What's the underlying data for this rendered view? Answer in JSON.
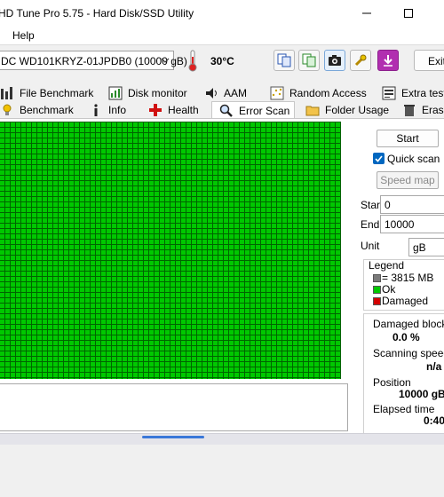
{
  "window": {
    "title": "HD Tune Pro 5.75 - Hard Disk/SSD Utility"
  },
  "menu": {
    "help": "Help"
  },
  "toolbar": {
    "drive": "DC WD101KRYZ-01JPDB0 (10000 gB)",
    "temperature": "30°C",
    "exit_label": "Exit"
  },
  "tabs_row1": [
    {
      "label": "File Benchmark",
      "icon": "file-benchmark-icon"
    },
    {
      "label": "Disk monitor",
      "icon": "disk-monitor-icon"
    },
    {
      "label": "AAM",
      "icon": "speaker-icon"
    },
    {
      "label": "Random Access",
      "icon": "random-access-icon"
    },
    {
      "label": "Extra tests",
      "icon": "extra-tests-icon"
    }
  ],
  "tabs_row2": [
    {
      "label": "Benchmark",
      "icon": "benchmark-icon"
    },
    {
      "label": "Info",
      "icon": "info-icon"
    },
    {
      "label": "Health",
      "icon": "health-icon"
    },
    {
      "label": "Error Scan",
      "icon": "magnifier-icon",
      "active": true
    },
    {
      "label": "Folder Usage",
      "icon": "folder-icon"
    },
    {
      "label": "Erase",
      "icon": "trash-icon"
    }
  ],
  "scan": {
    "start_button": "Start",
    "quick_scan_label": "Quick scan",
    "quick_scan_checked": true,
    "speed_map_button": "Speed map",
    "start_label": "Start",
    "start_value": "0",
    "end_label": "End",
    "end_value": "10000",
    "unit_label": "Unit",
    "unit_value": "gB"
  },
  "legend": {
    "title": "Legend",
    "block": "= 3815 MB",
    "ok": "Ok",
    "damaged": "Damaged"
  },
  "stats": {
    "damaged_blocks_label": "Damaged blocks",
    "damaged_blocks_value": "0.0 %",
    "scanning_speed_label": "Scanning speed",
    "scanning_speed_value": "n/a",
    "position_label": "Position",
    "position_value": "10000 gB",
    "elapsed_label": "Elapsed time",
    "elapsed_value": "0:40"
  },
  "colors": {
    "ok_block": "#00c800",
    "damaged_block": "#d40000",
    "grid_line": "#006400",
    "checkbox": "#0067c0"
  }
}
